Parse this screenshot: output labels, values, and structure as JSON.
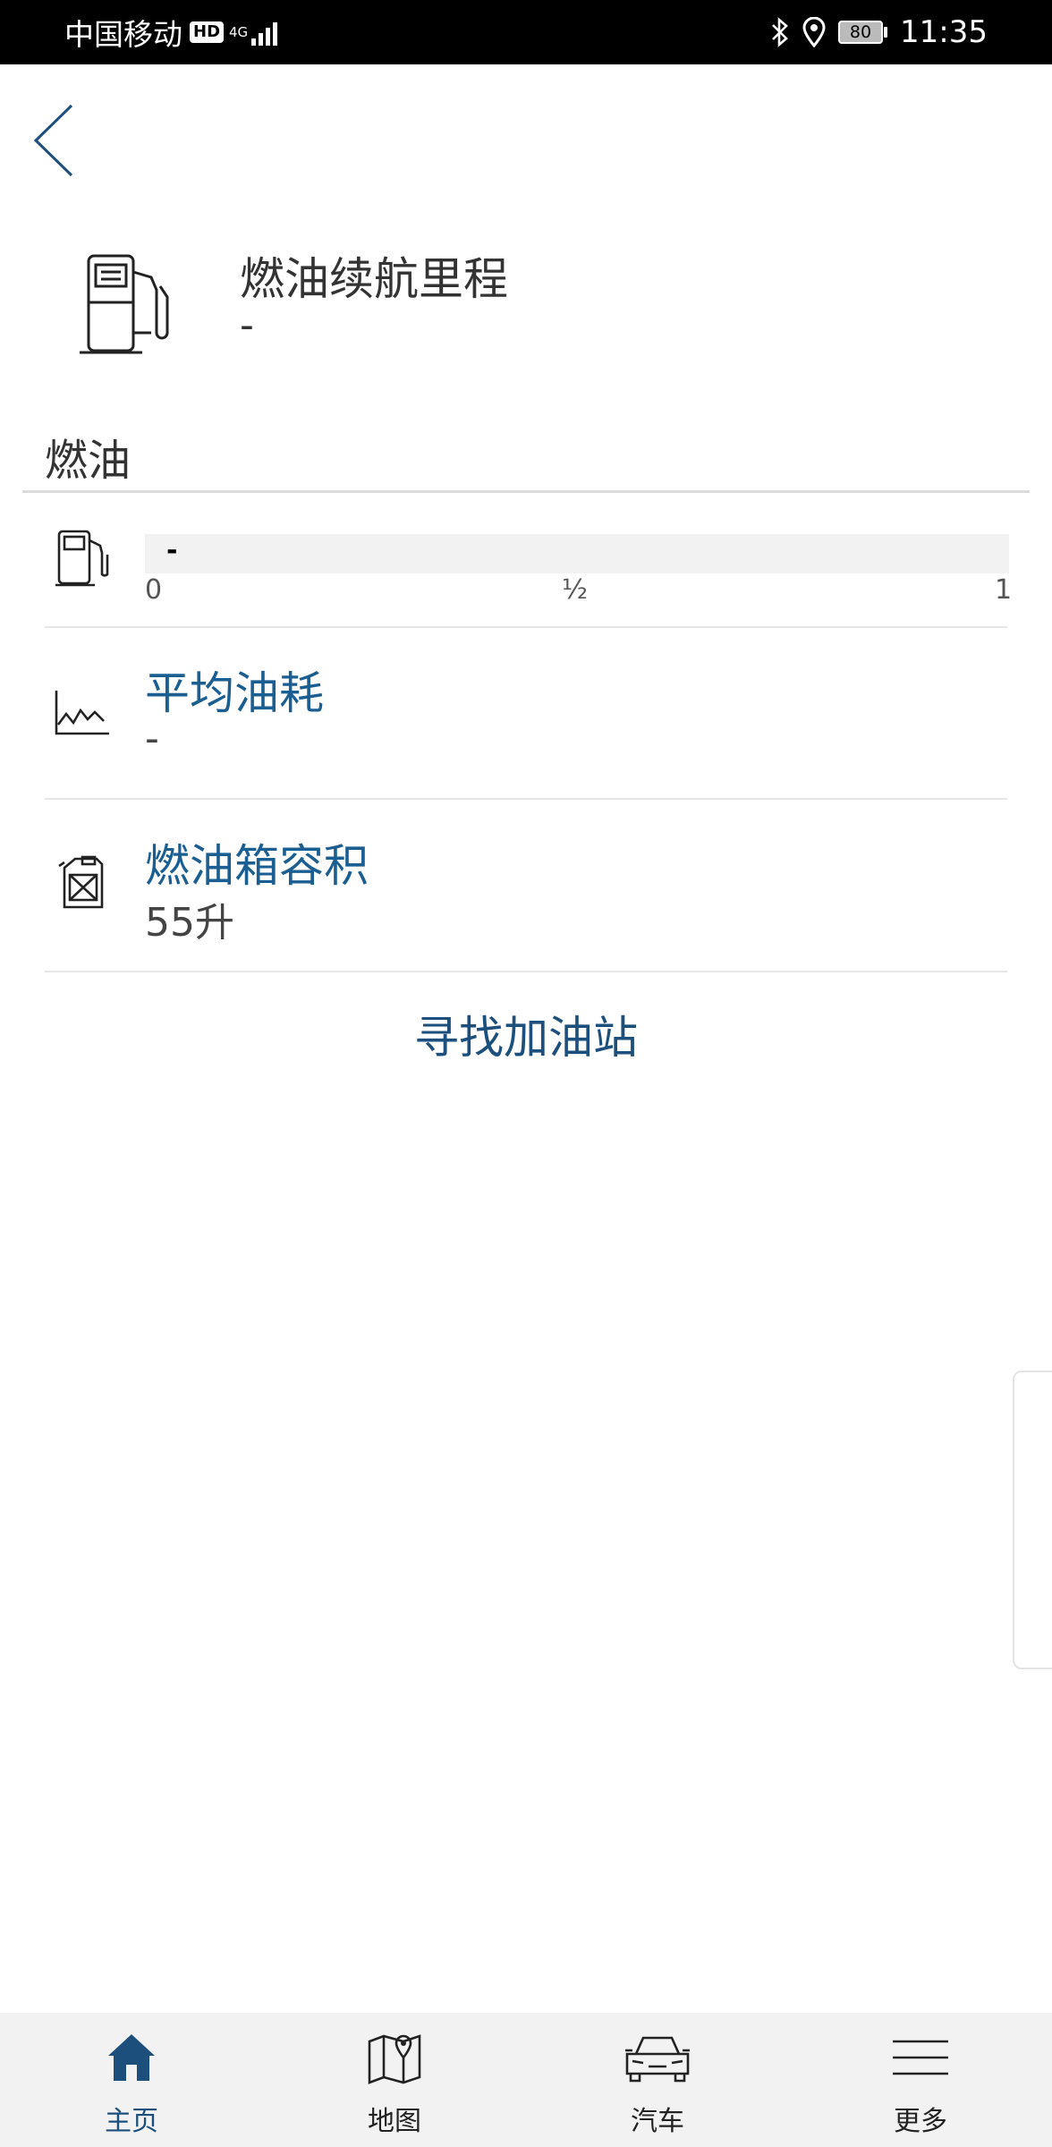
{
  "status_bar": {
    "carrier": "中国移动",
    "hd": "HD",
    "network": "4G",
    "battery": "80",
    "time": "11:35"
  },
  "range": {
    "title": "燃油续航里程",
    "value": "-"
  },
  "fuel_section": {
    "title": "燃油",
    "gauge": {
      "value": "-",
      "ticks": [
        "0",
        "½",
        "1"
      ]
    },
    "average_consumption": {
      "title": "平均油耗",
      "value": "-"
    },
    "tank_capacity": {
      "title": "燃油箱容积",
      "value": "55升"
    }
  },
  "find_station_label": "寻找加油站",
  "bottom_nav": {
    "items": [
      {
        "label": "主页",
        "icon": "home-icon",
        "active": true
      },
      {
        "label": "地图",
        "icon": "map-icon",
        "active": false
      },
      {
        "label": "汽车",
        "icon": "car-icon",
        "active": false
      },
      {
        "label": "更多",
        "icon": "menu-icon",
        "active": false
      }
    ]
  },
  "colors": {
    "accent": "#1b5e91",
    "nav_active": "#1d4f7c",
    "status_bar": "#000000"
  }
}
